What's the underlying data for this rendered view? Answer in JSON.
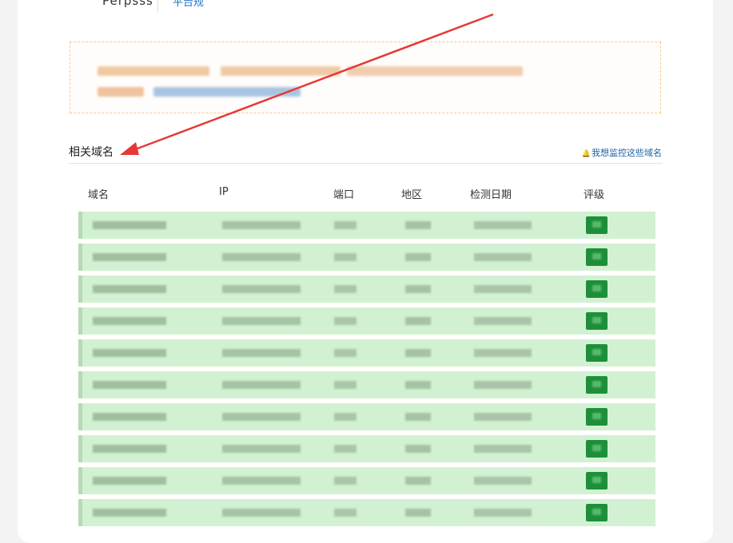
{
  "header": {
    "title_fragment": "Perpsss",
    "link_fragment": "平台规"
  },
  "section": {
    "title": "相关域名",
    "monitor_link": "我想监控这些域名",
    "monitor_icon": "bell-icon"
  },
  "table": {
    "columns": [
      "域名",
      "IP",
      "端口",
      "地区",
      "检测日期",
      "评级"
    ],
    "row_count": 10,
    "row_background": "#d2f1d2",
    "grade_color": "#1d8f3a"
  },
  "colors": {
    "accent": "#1a5fa3",
    "annotation_arrow": "#e53935",
    "notice_border": "#f3c98e"
  }
}
